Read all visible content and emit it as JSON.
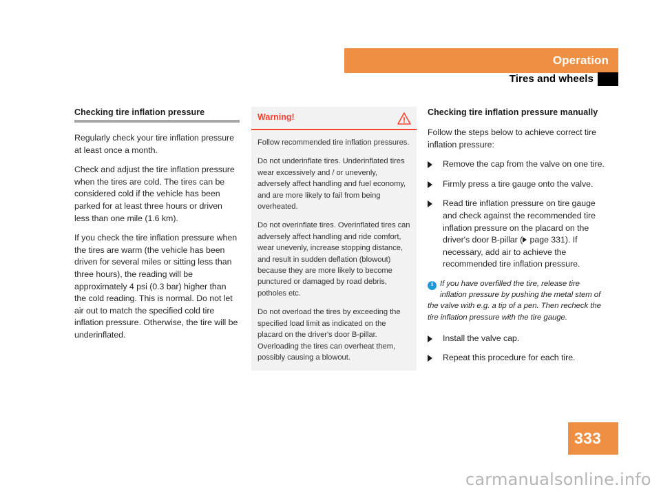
{
  "header": {
    "chapter": "Operation",
    "section": "Tires and wheels",
    "band_color": "#ef8f43",
    "tab_color": "#000000"
  },
  "left_column": {
    "heading": "Checking tire inflation pressure",
    "paragraphs": [
      "Regularly check your tire inflation pressure at least once a month.",
      "Check and adjust the tire inflation pressure when the tires are cold. The tires can be considered cold if the vehicle has been parked for at least three hours or driven less than one mile (1.6 km).",
      "If you check the tire inflation pressure when the tires are warm (the vehicle has been driven for several miles or sitting less than three hours), the reading will be approximately 4 psi (0.3 bar) higher than the cold reading. This is normal. Do not let air out to match the specified cold tire inflation pressure. Otherwise, the tire will be underinflated."
    ]
  },
  "warning_box": {
    "title": "Warning!",
    "icon": "warning-triangle-icon",
    "accent_color": "#f4442e",
    "background_color": "#f2f2f2",
    "paragraphs": [
      "Follow recommended tire inflation pressures.",
      "Do not underinflate tires. Underinflated tires wear excessively and / or unevenly, adversely affect handling and fuel economy, and are more likely to fail from being overheated.",
      "Do not overinflate tires. Overinflated tires can adversely affect handling and ride comfort, wear unevenly, increase stopping distance, and result in sudden deflation (blowout) because they are more likely to become punctured or damaged by road debris, potholes etc.",
      "Do not overload the tires by exceeding the specified load limit as indicated on the placard on the driver's door B-pillar. Overloading the tires can overheat them, possibly causing a blowout."
    ]
  },
  "right_column": {
    "heading": "Checking tire inflation pressure manually",
    "intro": "Follow the steps below to achieve correct tire inflation pressure:",
    "steps_before_note": [
      "Remove the cap from the valve on one tire.",
      "Firmly press a tire gauge onto the valve.",
      "Read tire inflation pressure on tire gauge and check against the recommended tire inflation pressure on the placard on the driver's door B-pillar (▷ page 331). If necessary, add air to achieve the recommended tire inflation pressure."
    ],
    "step3_part1": "Read tire inflation pressure on tire gauge and check against the recommended tire inflation pressure on the placard on the driver's door B-pillar (",
    "step3_xref": " page 331). If necessary, add air to achieve the recommended tire inflation pressure.",
    "info_note": {
      "icon": "info-circle-icon",
      "icon_color": "#1b9ad6",
      "text": "If you have overfilled the tire, release tire inflation pressure by pushing the metal stem of the valve with e.g. a tip of a pen. Then recheck the tire inflation pressure with the tire gauge."
    },
    "steps_after_note": [
      "Install the valve cap.",
      "Repeat this procedure for each tire."
    ]
  },
  "page_number": "333",
  "watermark": "carmanualsonline.info"
}
